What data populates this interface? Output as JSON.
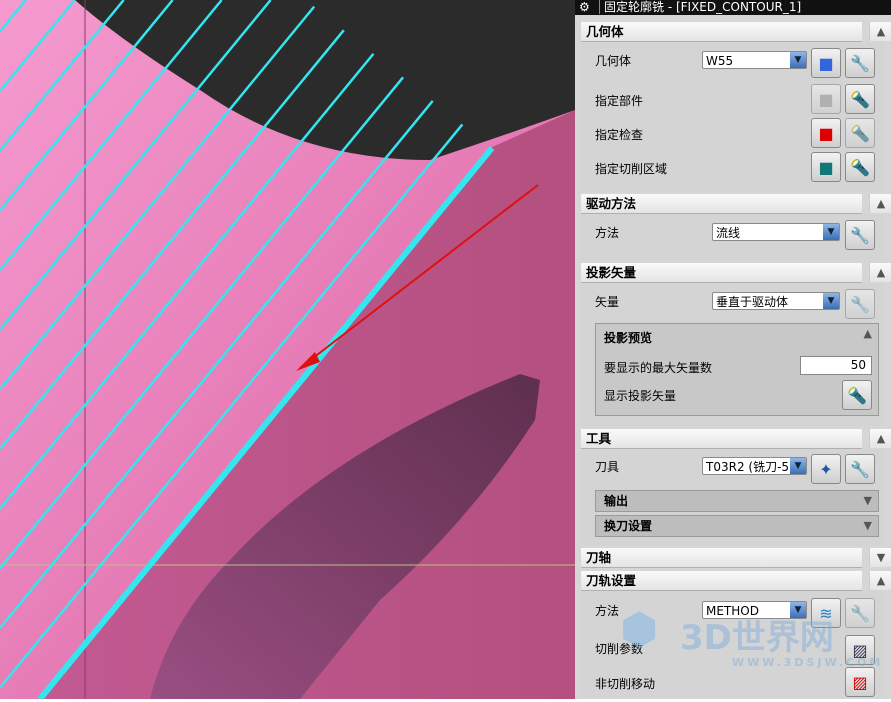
{
  "window": {
    "title": "固定轮廓铣 - [FIXED_CONTOUR_1]"
  },
  "sections": {
    "geometry": {
      "title": "几何体",
      "geom_label": "几何体",
      "geom_value": "W55",
      "part_label": "指定部件",
      "check_label": "指定检查",
      "cut_area_label": "指定切削区域"
    },
    "drive": {
      "title": "驱动方法",
      "method_label": "方法",
      "method_value": "流线"
    },
    "projection": {
      "title": "投影矢量",
      "vector_label": "矢量",
      "vector_value": "垂直于驱动体",
      "preview_title": "投影预览",
      "max_label": "要显示的最大矢量数",
      "max_value": "50",
      "show_label": "显示投影矢量"
    },
    "tool": {
      "title": "工具",
      "tool_label": "刀具",
      "tool_value": "T03R2 (铣刀-5",
      "output_title": "输出",
      "change_title": "换刀设置"
    },
    "axis": {
      "title": "刀轴"
    },
    "path": {
      "title": "刀轨设置",
      "method_label": "方法",
      "method_value": "METHOD",
      "cut_params_label": "切削参数",
      "noncut_label": "非切削移动"
    }
  },
  "watermark": {
    "text": "3D世界网",
    "url": "WWW.3DSJW.COM"
  },
  "colors": {
    "surface": "#f08ac6",
    "dark": "#2b2b2b",
    "toolpath": "#33e6f0",
    "arrow": "#e01010"
  }
}
